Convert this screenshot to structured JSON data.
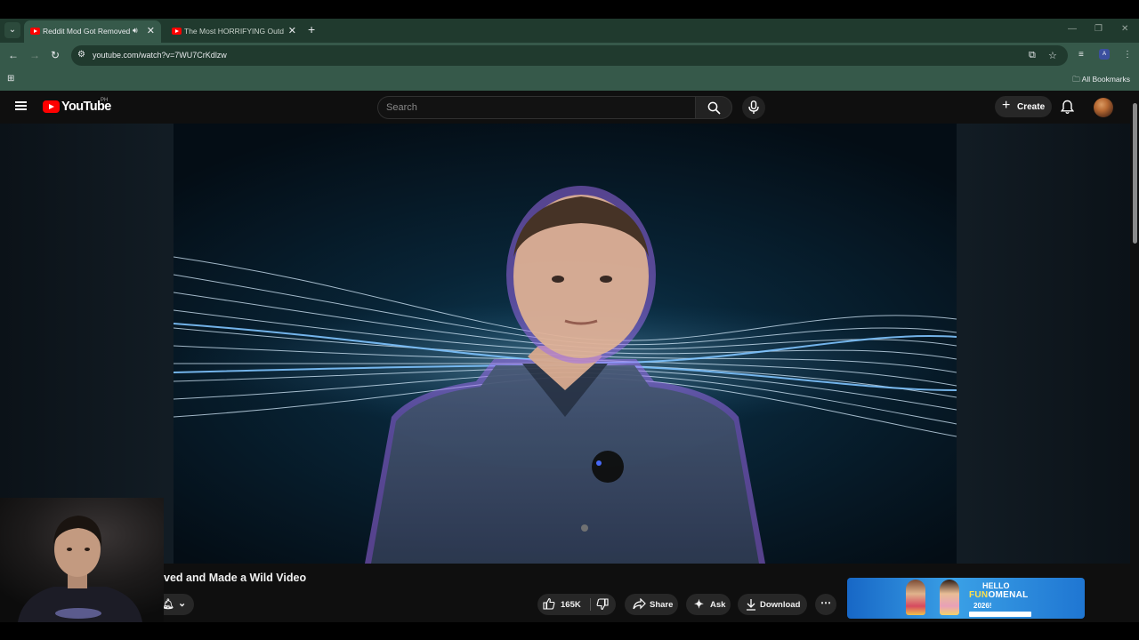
{
  "browser": {
    "tabs": [
      {
        "title": "Reddit Mod Got Removed and Made a Wild Video",
        "active": true,
        "audio": true
      },
      {
        "title": "The Most HORRIFYING Outdoor Stories",
        "active": false
      }
    ],
    "url": "youtube.com/watch?v=7WU7CrKdlzw",
    "bookmarks_label": "All Bookmarks",
    "extension_badge": "A"
  },
  "youtube": {
    "logo_text": "YouTube",
    "country_code": "PH",
    "search_placeholder": "Search",
    "create_label": "Create"
  },
  "video": {
    "title_visible": "ved and Made a Wild Video",
    "likes": "165K",
    "share_label": "Share",
    "ask_label": "Ask",
    "download_label": "Download"
  },
  "ad": {
    "line1": "HELLO",
    "line2_prefix": "FUN",
    "line2_suffix": "OMENAL",
    "line3": "2026!"
  },
  "colors": {
    "tab_strip": "#203a2e",
    "toolbar": "#36594a",
    "yt_bg": "#0f0f0f",
    "logo_red": "#ff0000"
  }
}
